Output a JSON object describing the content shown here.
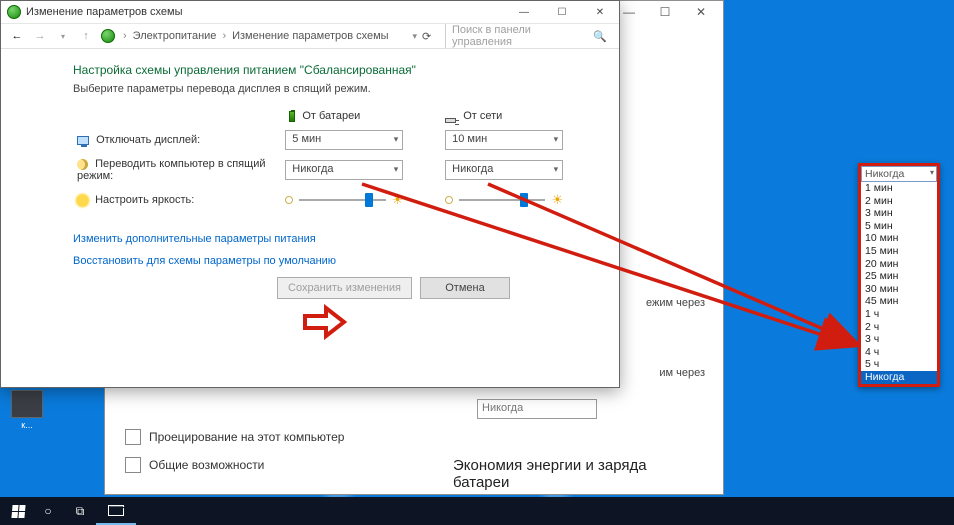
{
  "window": {
    "title": "Изменение параметров схемы",
    "min": "—",
    "max": "☐",
    "close": "✕"
  },
  "bg_window": {
    "min": "—",
    "max": "☐",
    "close": "✕",
    "text_behind1": "ежим через",
    "text_behind2": "им через",
    "proj": "Проецирование на этот компьютер",
    "shared": "Общие возможности",
    "energy_title": "Экономия энергии и заряда батареи",
    "hidden_select": "Никогда"
  },
  "toolbar": {
    "crumb1": "Электропитание",
    "crumb2": "Изменение параметров схемы",
    "search_placeholder": "Поиск в панели управления"
  },
  "page": {
    "title": "Настройка схемы управления питанием \"Сбалансированная\"",
    "instr": "Выберите параметры перевода дисплея в спящий режим.",
    "col_battery": "От батареи",
    "col_ac": "От сети",
    "row_display": "Отключать дисплей:",
    "row_sleep": "Переводить компьютер в спящий режим:",
    "row_bright": "Настроить яркость:",
    "val_display_bat": "5 мин",
    "val_display_ac": "10 мин",
    "val_sleep_bat": "Никогда",
    "val_sleep_ac": "Никогда",
    "link_adv": "Изменить дополнительные параметры питания",
    "link_restore": "Восстановить для схемы параметры по умолчанию",
    "btn_save": "Сохранить изменения",
    "btn_cancel": "Отмена"
  },
  "dropdown": {
    "current": "Никогда",
    "options": [
      "1 мин",
      "2 мин",
      "3 мин",
      "5 мин",
      "10 мин",
      "15 мин",
      "20 мин",
      "25 мин",
      "30 мин",
      "45 мин",
      "1 ч",
      "2 ч",
      "3 ч",
      "4 ч",
      "5 ч",
      "Никогда"
    ]
  },
  "desktop_icon": "к..."
}
